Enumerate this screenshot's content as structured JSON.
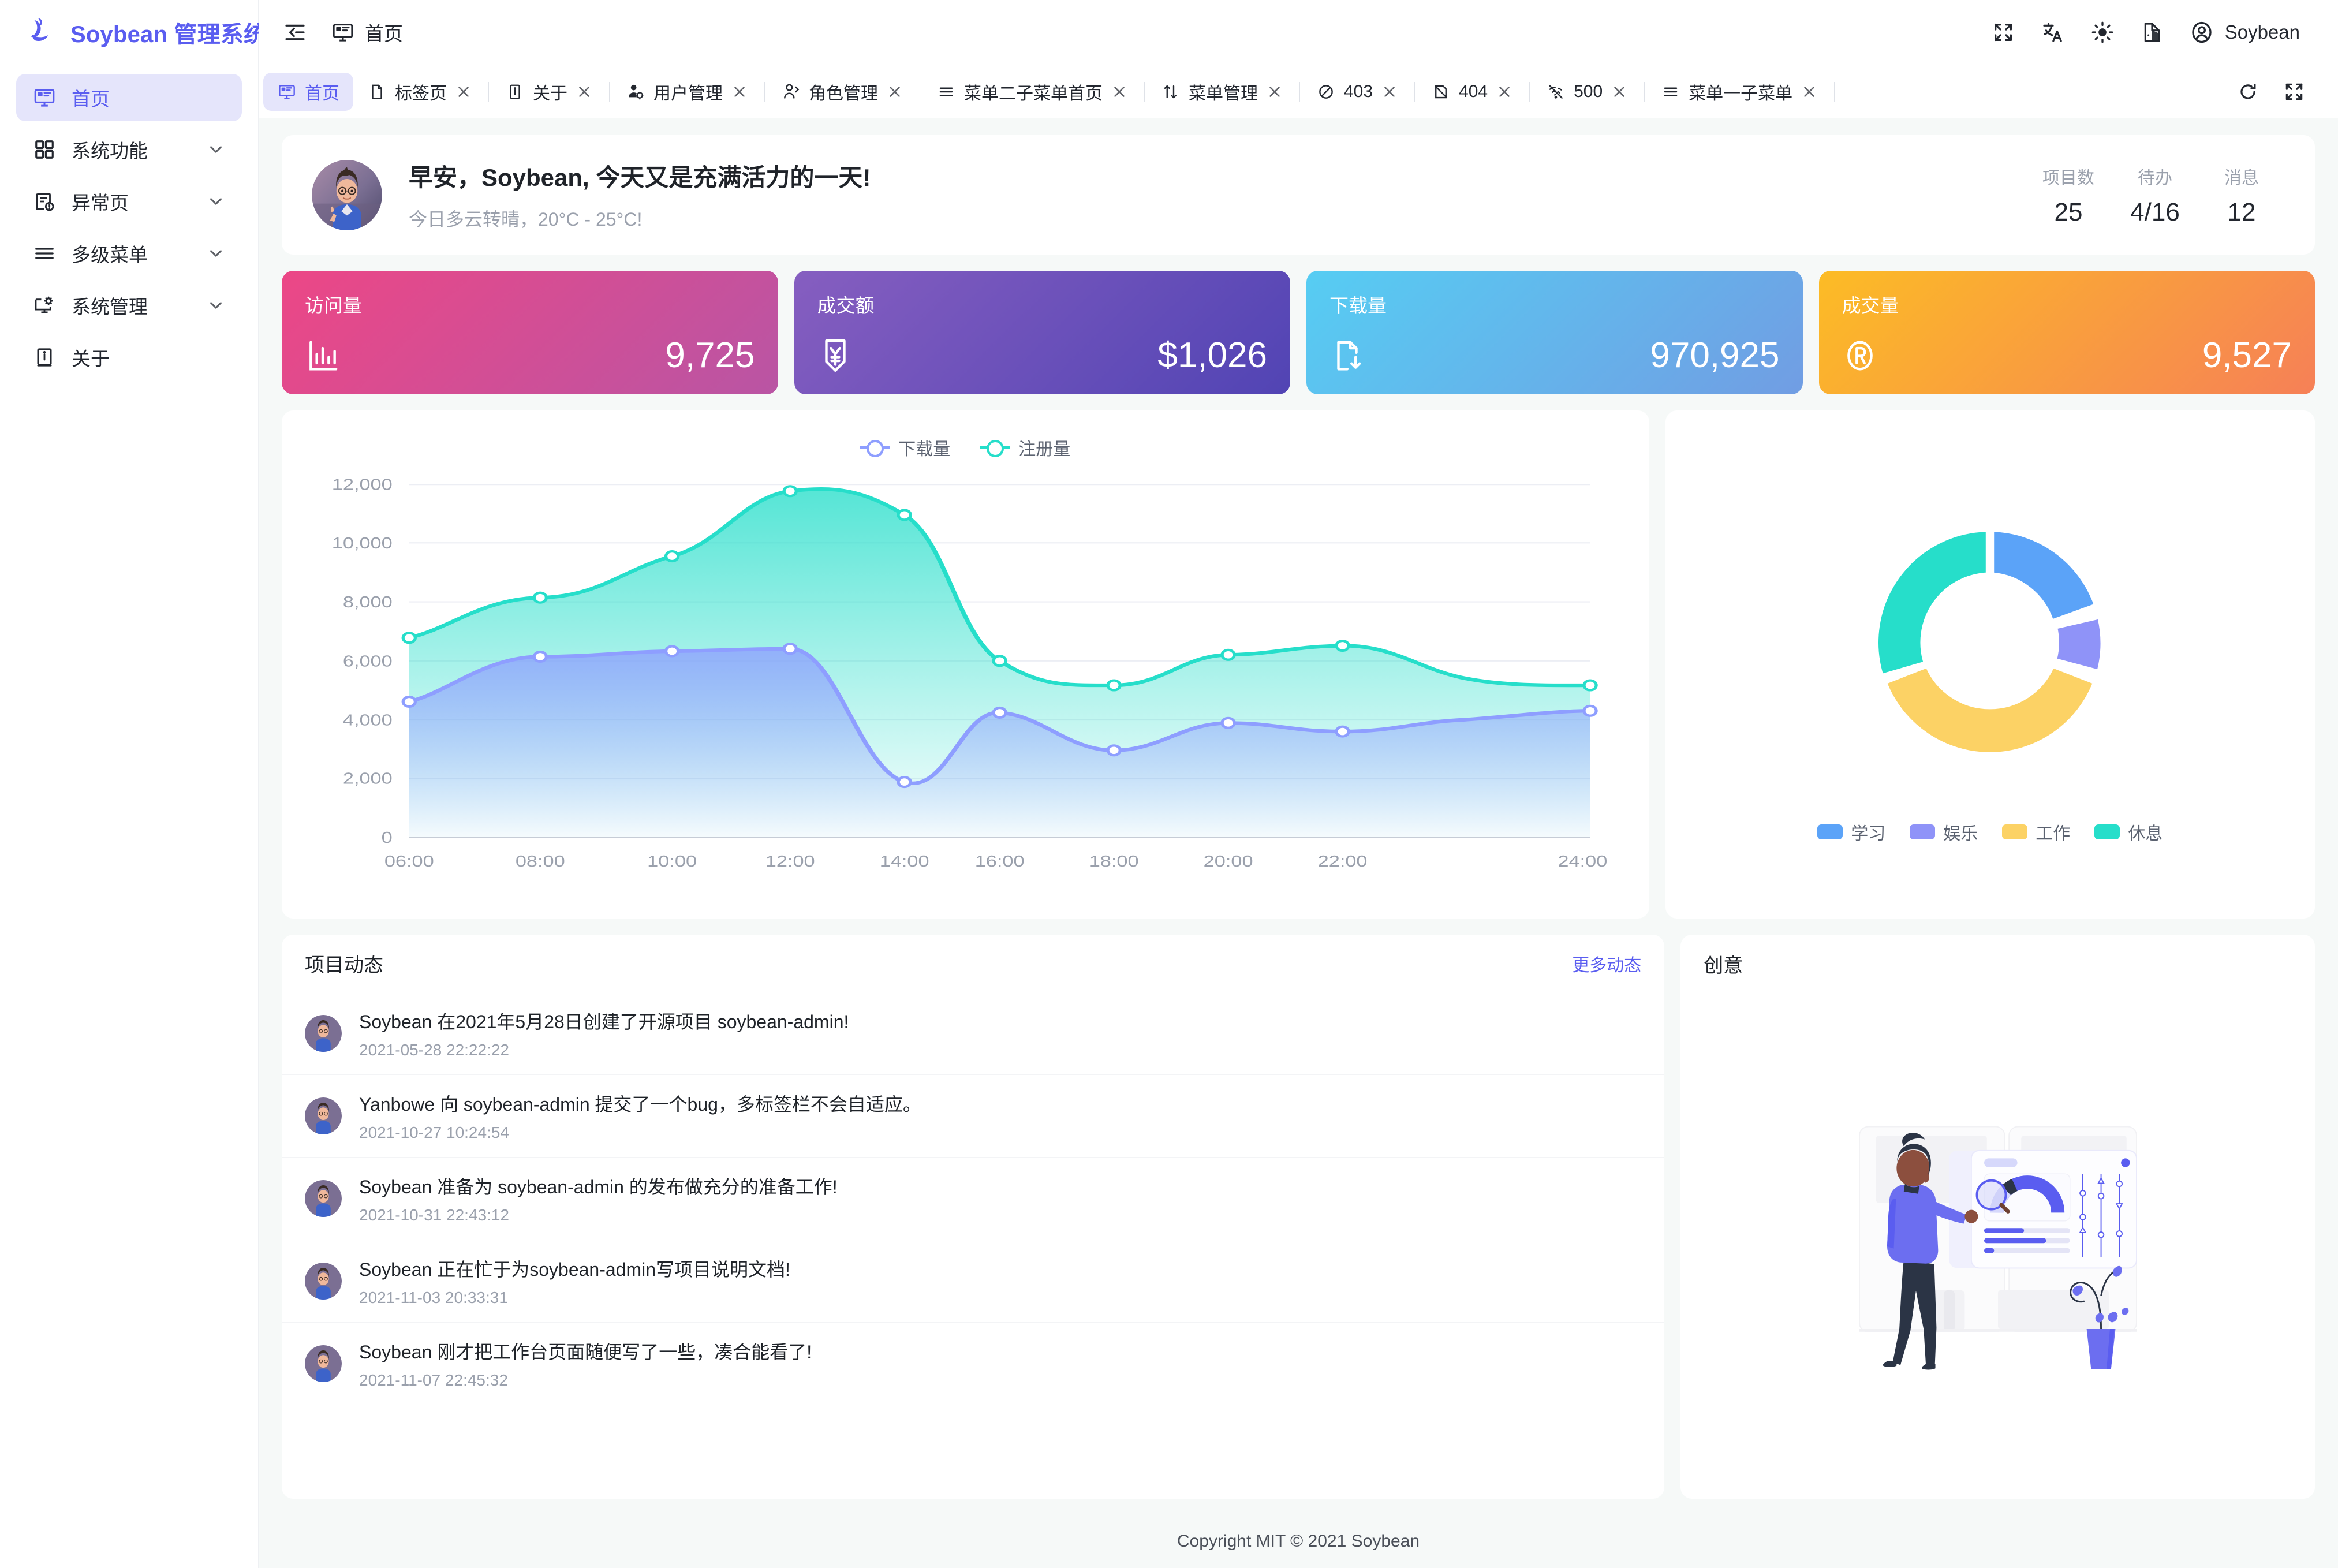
{
  "brand": {
    "name": "Soybean 管理系统",
    "logo_icon": "soybean-logo-icon",
    "accent": "#5a5df0"
  },
  "sidebar": {
    "items": [
      {
        "label": "首页",
        "icon": "monitor-icon",
        "active": true,
        "expandable": false
      },
      {
        "label": "系统功能",
        "icon": "grid-icon",
        "active": false,
        "expandable": true
      },
      {
        "label": "异常页",
        "icon": "doc-alert-icon",
        "active": false,
        "expandable": true
      },
      {
        "label": "多级菜单",
        "icon": "menu-lines-icon",
        "active": false,
        "expandable": true
      },
      {
        "label": "系统管理",
        "icon": "monitor-gear-icon",
        "active": false,
        "expandable": true
      },
      {
        "label": "关于",
        "icon": "info-book-icon",
        "active": false,
        "expandable": false
      }
    ]
  },
  "topbar": {
    "collapse_icon": "collapse-sidebar-icon",
    "breadcrumb": {
      "icon": "monitor-icon",
      "label": "首页"
    },
    "actions": [
      {
        "name": "fullscreen-icon",
        "label": "全屏"
      },
      {
        "name": "translate-icon",
        "label": "语言"
      },
      {
        "name": "sun-icon",
        "label": "主题"
      },
      {
        "name": "theme-settings-icon",
        "label": "主题配置"
      }
    ],
    "user": {
      "name": "Soybean",
      "icon": "user-circle-icon"
    }
  },
  "tabbar": {
    "tabs": [
      {
        "label": "首页",
        "icon": "monitor-icon",
        "active": true,
        "closable": false
      },
      {
        "label": "标签页",
        "icon": "page-icon",
        "active": false,
        "closable": true
      },
      {
        "label": "关于",
        "icon": "info-icon",
        "active": false,
        "closable": true
      },
      {
        "label": "用户管理",
        "icon": "user-gear-icon",
        "active": false,
        "closable": true
      },
      {
        "label": "角色管理",
        "icon": "person-check-icon",
        "active": false,
        "closable": true
      },
      {
        "label": "菜单二子菜单首页",
        "icon": "menu-lines-icon",
        "active": false,
        "closable": true
      },
      {
        "label": "菜单管理",
        "icon": "sort-icon",
        "active": false,
        "closable": true
      },
      {
        "label": "403",
        "icon": "forbidden-icon",
        "active": false,
        "closable": true
      },
      {
        "label": "404",
        "icon": "broken-page-icon",
        "active": false,
        "closable": true
      },
      {
        "label": "500",
        "icon": "no-signal-icon",
        "active": false,
        "closable": true
      },
      {
        "label": "菜单一子菜单",
        "icon": "menu-lines-icon",
        "active": false,
        "closable": true
      }
    ],
    "reload_icon": "reload-icon",
    "fullscreen_icon": "fullscreen-icon"
  },
  "greeting": {
    "title": "早安，Soybean, 今天又是充满活力的一天!",
    "subtitle": "今日多云转晴，20°C - 25°C!",
    "stats": [
      {
        "label": "项目数",
        "value": "25"
      },
      {
        "label": "待办",
        "value": "4/16"
      },
      {
        "label": "消息",
        "value": "12"
      }
    ]
  },
  "stat_cards": [
    {
      "title": "访问量",
      "value": "9,725",
      "icon": "bar-chart-icon",
      "from": "#ec4786",
      "to": "#b955a4"
    },
    {
      "title": "成交额",
      "value": "$1,026",
      "icon": "money-down-icon",
      "from": "#865ec0",
      "to": "#5144b4"
    },
    {
      "title": "下载量",
      "value": "970,925",
      "icon": "file-down-icon",
      "from": "#56cdf3",
      "to": "#719de3"
    },
    {
      "title": "成交量",
      "value": "9,527",
      "icon": "registered-icon",
      "from": "#fcbc25",
      "to": "#f68057"
    }
  ],
  "chart_data": [
    {
      "type": "area",
      "title": "",
      "x": [
        "06:00",
        "08:00",
        "10:00",
        "12:00",
        "14:00",
        "16:00",
        "18:00",
        "20:00",
        "22:00",
        "24:00"
      ],
      "xlabel": "",
      "ylabel": "",
      "ylim": [
        0,
        12000
      ],
      "yticks": [
        "0",
        "2,000",
        "4,000",
        "6,000",
        "8,000",
        "10,000",
        "12,000"
      ],
      "grid": true,
      "legend_position": "top",
      "series": [
        {
          "name": "下载量",
          "color": "#8e9eff",
          "values": [
            4623,
            6145,
            6268,
            6411,
            1890,
            4251,
            2978,
            3880,
            3606,
            4311
          ]
        },
        {
          "name": "注册量",
          "color": "#26deca",
          "values": [
            6790,
            8160,
            9210,
            10960,
            10180,
            6860,
            5190,
            6210,
            6560,
            5180
          ]
        }
      ]
    },
    {
      "type": "pie",
      "title": "",
      "categories": [
        "学习",
        "娱乐",
        "工作",
        "休息"
      ],
      "values": [
        20,
        10,
        30,
        25
      ],
      "colors": [
        "#5ba3f8",
        "#8f93f8",
        "#fcd265",
        "#26deca"
      ],
      "legend_position": "bottom",
      "donut": true
    }
  ],
  "news": {
    "title": "项目动态",
    "more_label": "更多动态",
    "items": [
      {
        "text": "Soybean 在2021年5月28日创建了开源项目 soybean-admin!",
        "time": "2021-05-28 22:22:22"
      },
      {
        "text": "Yanbowe 向 soybean-admin 提交了一个bug，多标签栏不会自适应。",
        "time": "2021-10-27 10:24:54"
      },
      {
        "text": "Soybean 准备为 soybean-admin 的发布做充分的准备工作!",
        "time": "2021-10-31 22:43:12"
      },
      {
        "text": "Soybean 正在忙于为soybean-admin写项目说明文档!",
        "time": "2021-11-03 20:33:31"
      },
      {
        "text": "Soybean 刚才把工作台页面随便写了一些，凑合能看了!",
        "time": "2021-11-07 22:45:32"
      }
    ]
  },
  "idea": {
    "title": "创意",
    "illustration": "person-analyzing-dashboard-illustration"
  },
  "footer": {
    "text": "Copyright MIT © 2021 Soybean"
  }
}
